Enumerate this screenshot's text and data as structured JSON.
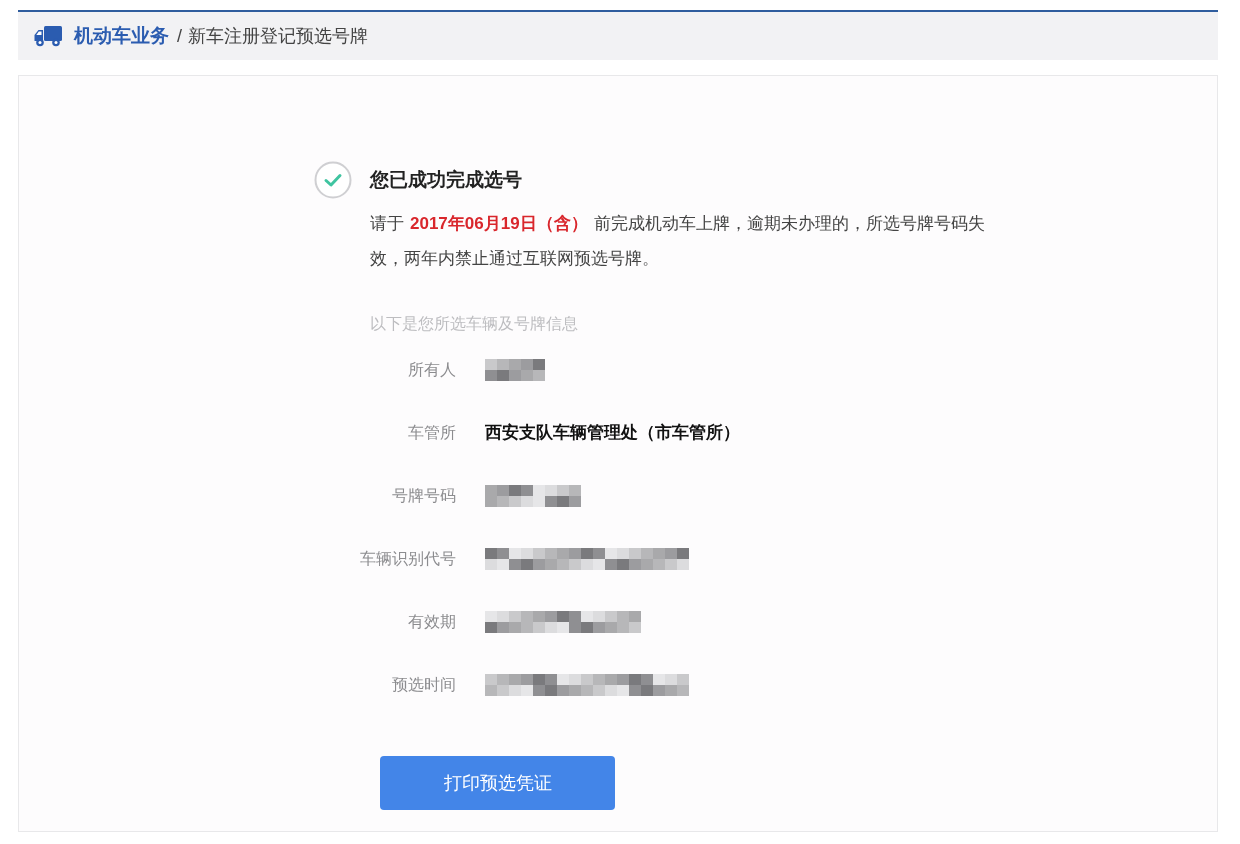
{
  "breadcrumb": {
    "section": "机动车业务",
    "separator": "/",
    "page": "新车注册登记预选号牌"
  },
  "result": {
    "title": "您已成功完成选号",
    "notice": {
      "before": "请于",
      "deadline": "2017年06月19日（含）",
      "after": "前完成机动车上牌，逾期未办理的，所选号牌号码失效，两年内禁止通过互联网预选号牌。"
    }
  },
  "details": {
    "heading": "以下是您所选车辆及号牌信息",
    "rows": [
      {
        "label": "所有人",
        "kind": "redacted"
      },
      {
        "label": "车管所",
        "kind": "text",
        "value": "西安支队车辆管理处（市车管所）"
      },
      {
        "label": "号牌号码",
        "kind": "redacted"
      },
      {
        "label": "车辆识别代号",
        "kind": "redacted"
      },
      {
        "label": "有效期",
        "kind": "redacted"
      },
      {
        "label": "预选时间",
        "kind": "redacted"
      }
    ]
  },
  "buttons": [
    {
      "label": "打印预选凭证"
    }
  ]
}
